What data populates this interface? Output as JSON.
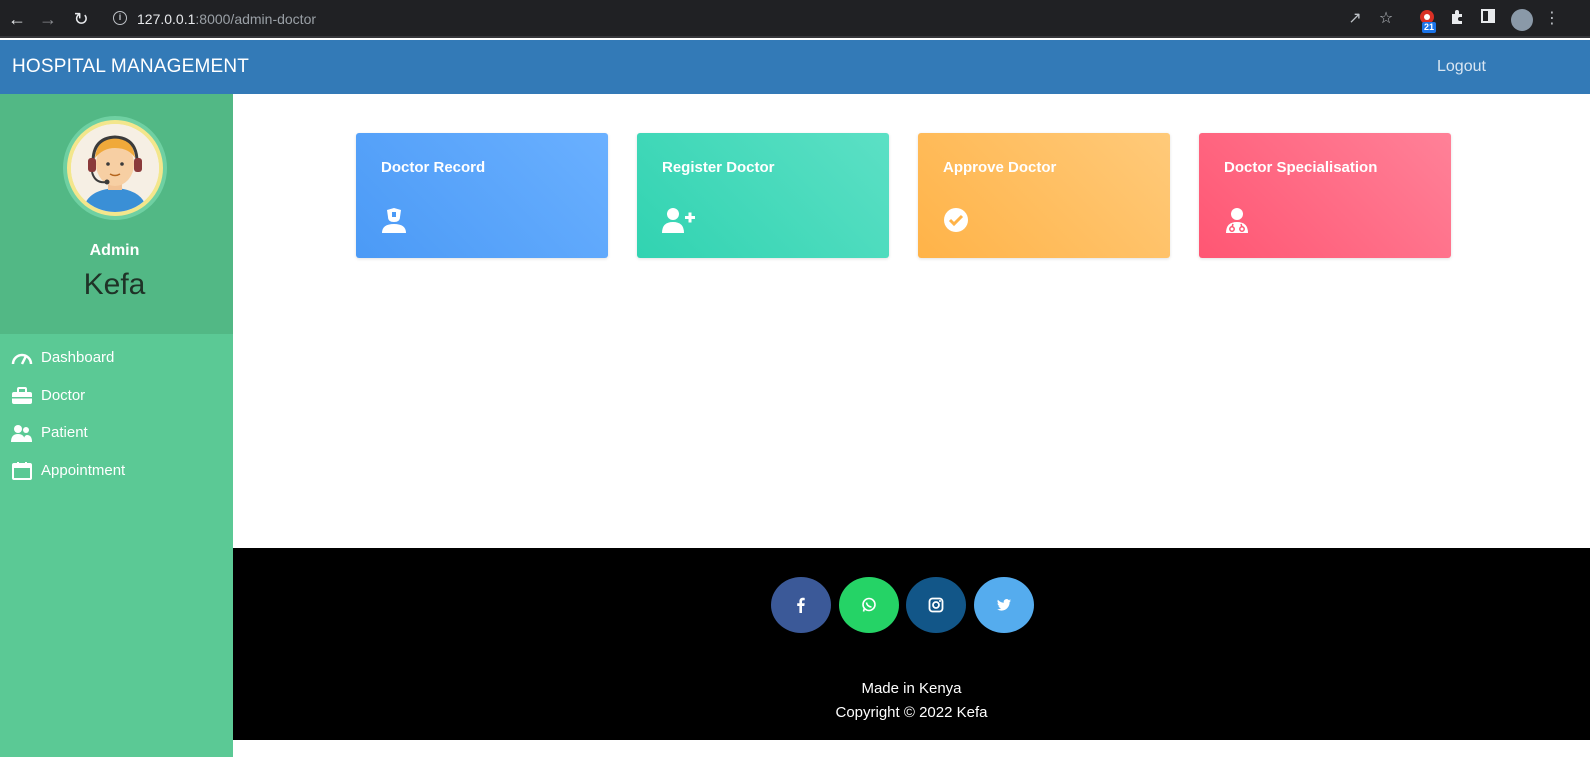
{
  "browser": {
    "url_host": "127.0.0.1",
    "url_rest": ":8000/admin-doctor",
    "extension_badge": "21"
  },
  "navbar": {
    "brand": "HOSPITAL MANAGEMENT",
    "logout": "Logout"
  },
  "sidebar": {
    "role": "Admin",
    "name": "Kefa",
    "items": [
      {
        "label": "Dashboard",
        "icon": "tachometer-icon"
      },
      {
        "label": "Doctor",
        "icon": "briefcase-icon"
      },
      {
        "label": "Patient",
        "icon": "users-icon"
      },
      {
        "label": "Appointment",
        "icon": "calendar-icon"
      }
    ]
  },
  "cards": [
    {
      "title": "Doctor Record",
      "icon": "user-nurse-icon",
      "color": "#4b9af6"
    },
    {
      "title": "Register Doctor",
      "icon": "user-plus-icon",
      "color": "#31d3b1"
    },
    {
      "title": "Approve Doctor",
      "icon": "check-circle-icon",
      "color": "#ffb348"
    },
    {
      "title": "Doctor Specialisation",
      "icon": "user-md-icon",
      "color": "#ff5673"
    }
  ],
  "footer": {
    "social": [
      "facebook-icon",
      "whatsapp-icon",
      "instagram-icon",
      "twitter-icon"
    ],
    "made_in": "Made in Kenya",
    "copyright": "Copyright © 2022 Kefa"
  },
  "colors": {
    "navbar": "#337ab7",
    "sidebar": "#5bc995",
    "footer": "#000000"
  }
}
